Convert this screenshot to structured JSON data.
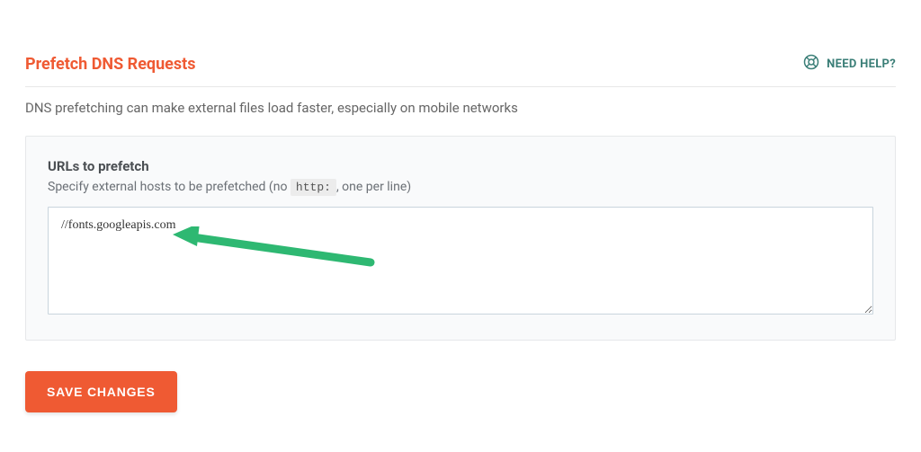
{
  "header": {
    "title": "Prefetch DNS Requests",
    "help_label": "NEED HELP?"
  },
  "description": "DNS prefetching can make external files load faster, especially on mobile networks",
  "panel": {
    "title": "URLs to prefetch",
    "subtitle_pre": "Specify external hosts to be prefetched (no ",
    "subtitle_code": "http:",
    "subtitle_post": ", one per line)",
    "textarea_value": "//fonts.googleapis.com"
  },
  "buttons": {
    "save_label": "SAVE CHANGES"
  }
}
